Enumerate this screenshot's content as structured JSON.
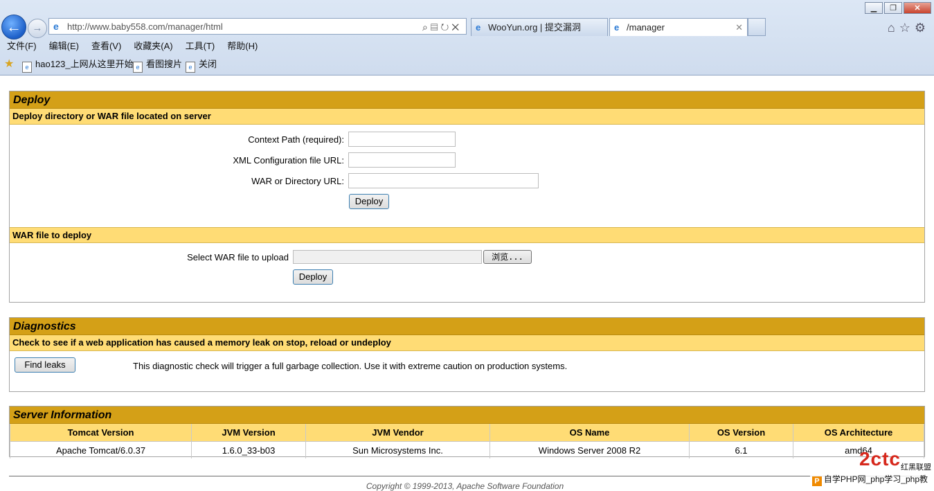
{
  "browser": {
    "url": "http://www.baby558.com/manager/html",
    "tabs": [
      {
        "label": "WooYun.org | 提交漏洞"
      },
      {
        "label": "/manager"
      }
    ],
    "menu": [
      "文件(F)",
      "编辑(E)",
      "查看(V)",
      "收藏夹(A)",
      "工具(T)",
      "帮助(H)"
    ],
    "favorites": [
      "hao123_上网从这里开始",
      "看图搜片",
      "关闭"
    ]
  },
  "deploy": {
    "title": "Deploy",
    "server_section": "Deploy directory or WAR file located on server",
    "context_path_label": "Context Path (required):",
    "xml_config_label": "XML Configuration file URL:",
    "war_dir_label": "WAR or Directory URL:",
    "deploy_button": "Deploy",
    "war_section": "WAR file to deploy",
    "select_war_label": "Select WAR file to upload",
    "browse_button": "浏览...",
    "upload_deploy_button": "Deploy"
  },
  "diagnostics": {
    "title": "Diagnostics",
    "subtitle": "Check to see if a web application has caused a memory leak on stop, reload or undeploy",
    "find_leaks_button": "Find leaks",
    "note": "This diagnostic check will trigger a full garbage collection. Use it with extreme caution on production systems."
  },
  "server_info": {
    "title": "Server Information",
    "headers": [
      "Tomcat Version",
      "JVM Version",
      "JVM Vendor",
      "OS Name",
      "OS Version",
      "OS Architecture"
    ],
    "values": [
      "Apache Tomcat/6.0.37",
      "1.6.0_33-b03",
      "Sun Microsystems Inc.",
      "Windows Server 2008 R2",
      "6.1",
      "amd64"
    ]
  },
  "footer": {
    "copyright": "Copyright © 1999-2013, Apache Software Foundation"
  },
  "watermark": {
    "text": "自学PHP网_php学习_php教",
    "cn": "红黑联盟"
  }
}
